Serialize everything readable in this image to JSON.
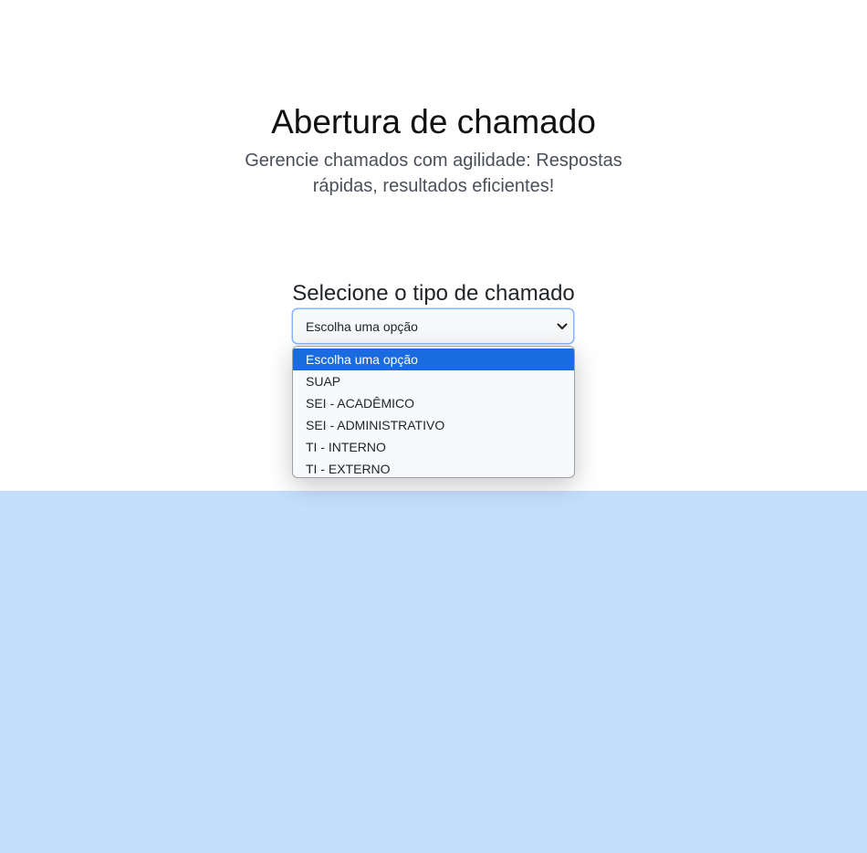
{
  "header": {
    "title": "Abertura de chamado",
    "subtitle": "Gerencie chamados com agilidade: Respostas rápidas, resultados eficientes!"
  },
  "form": {
    "select_label": "Selecione o tipo de chamado",
    "selected_value": "Escolha uma opção",
    "options": [
      "Escolha uma opção",
      "SUAP",
      "SEI - ACADÊMICO",
      "SEI - ADMINISTRATIVO",
      "TI - INTERNO",
      "TI - EXTERNO"
    ],
    "highlighted_index": 0
  },
  "icons": {
    "select_arrow": "chevron-down-icon"
  },
  "colors": {
    "bottom_background": "#c4dffd",
    "highlight": "#1a6ae0",
    "focus_border": "#86b7fe"
  }
}
